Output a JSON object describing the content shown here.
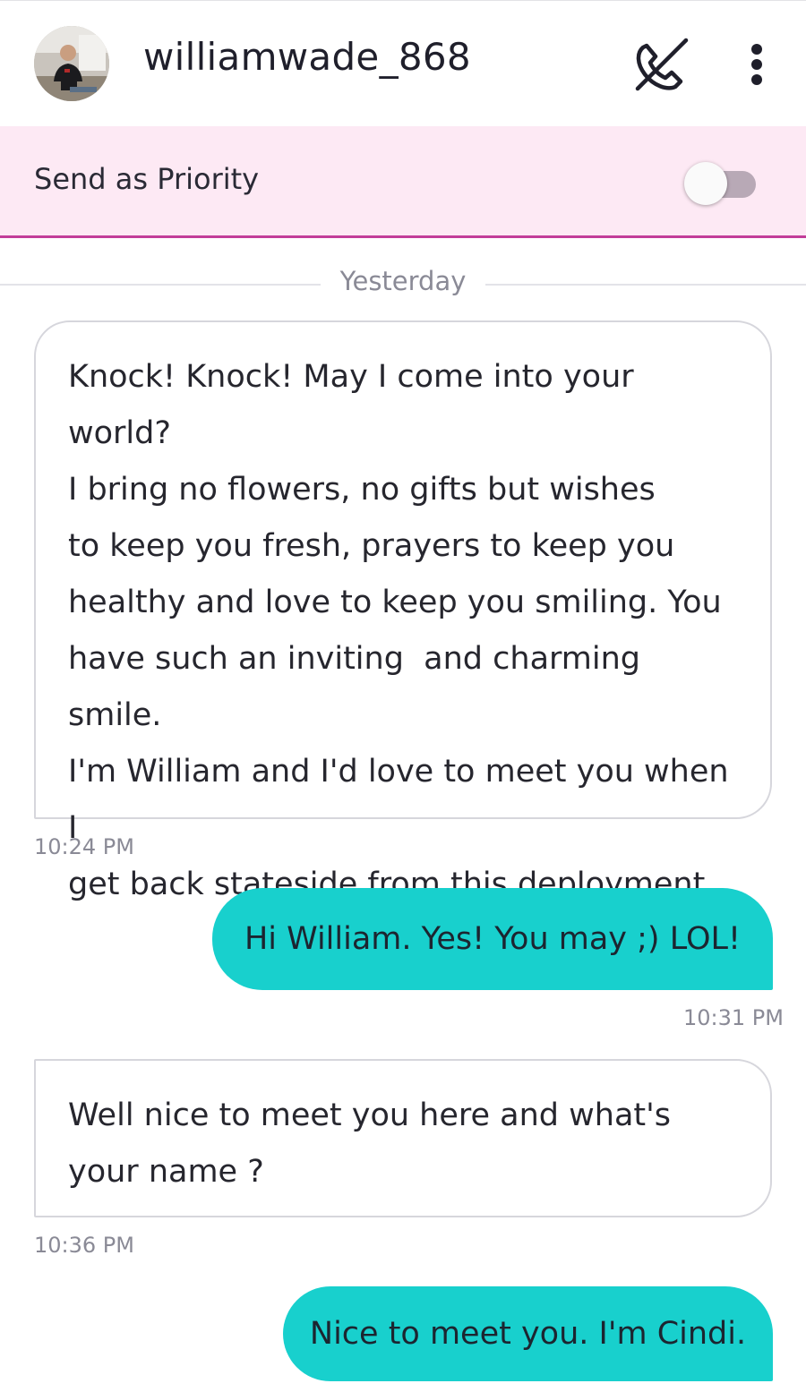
{
  "header": {
    "username": "williamwade_868",
    "avatar_icon": "user-photo",
    "call_icon": "phone-call-icon",
    "menu_icon": "more-vertical-icon"
  },
  "priority": {
    "label": "Send as Priority",
    "enabled": false,
    "accent_color": "#c23d99",
    "background_color": "#fde9f4"
  },
  "conversation": {
    "day_divider": "Yesterday",
    "messages": [
      {
        "direction": "incoming",
        "text": "Knock! Knock! May I come into your\nworld?\nI bring no flowers, no gifts but wishes\nto keep you fresh, prayers to keep you\nhealthy and love to keep you smiling. You\nhave such an inviting  and charming smile.\nI'm William and I'd love to meet you when I\nget back stateside from this deployment.",
        "time": "10:24 PM"
      },
      {
        "direction": "outgoing",
        "text": "Hi William. Yes! You may ;) LOL!",
        "time": "10:31 PM"
      },
      {
        "direction": "incoming",
        "text": "Well nice to meet you here and what's\nyour name ?",
        "time": "10:36 PM"
      },
      {
        "direction": "outgoing",
        "text": "Nice to meet you. I'm Cindi.",
        "time": ""
      }
    ]
  },
  "colors": {
    "outgoing_bubble": "#18d0cd",
    "incoming_border": "#d6d6dc",
    "timestamp": "#8a8a96"
  }
}
